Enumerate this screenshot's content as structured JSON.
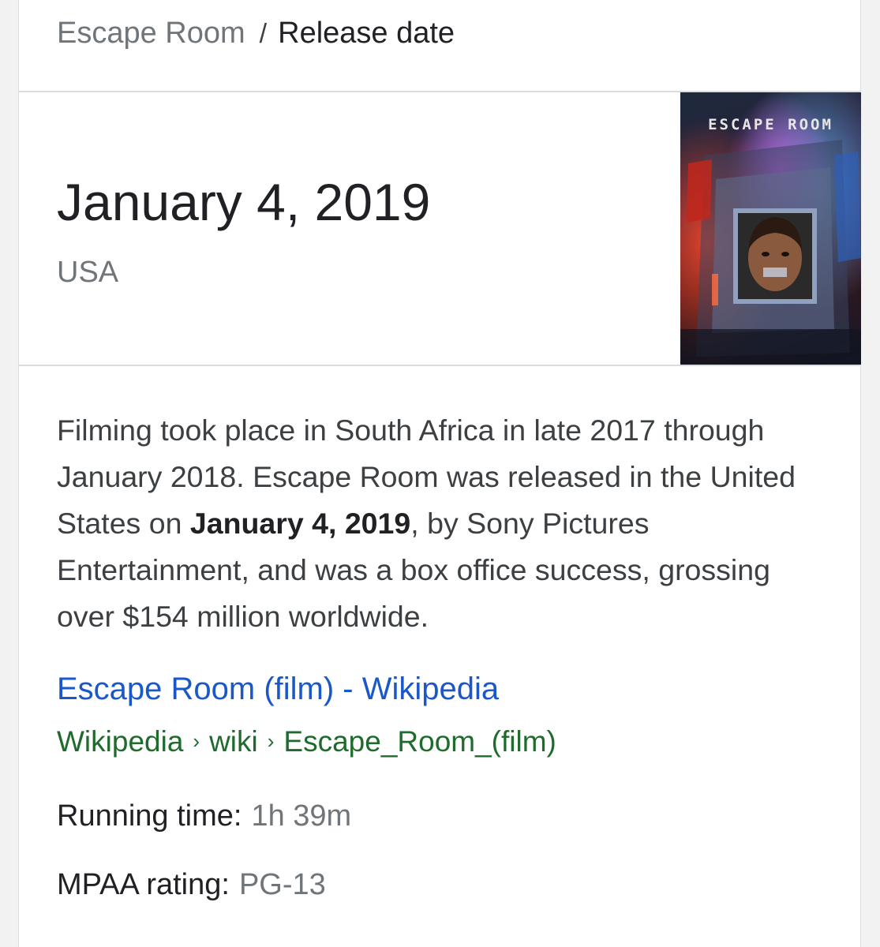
{
  "breadcrumb": {
    "parent": "Escape Room",
    "separator": "/",
    "current": "Release date"
  },
  "answer": {
    "date": "January 4, 2019",
    "region": "USA"
  },
  "poster": {
    "title": "ESCAPE ROOM",
    "icon": "movie-poster-image"
  },
  "snippet": {
    "before": "Filming took place in South Africa in late 2017 through January 2018. Escape Room was released in the United States on ",
    "bold": "January 4, 2019",
    "after": ", by Sony Pictures Entertainment, and was a box office success, grossing over $154 million worldwide."
  },
  "source": {
    "title": "Escape Room (film) - Wikipedia",
    "url_parts": [
      "Wikipedia",
      "wiki",
      "Escape_Room_(film)"
    ],
    "url_sep": "›"
  },
  "facts": {
    "running_time": {
      "label": "Running time:",
      "value": "1h 39m"
    },
    "mpaa_rating": {
      "label": "MPAA rating:",
      "value": "PG-13"
    }
  },
  "colors": {
    "link": "#1a57c9",
    "url": "#1e6b2c",
    "muted": "#70757a",
    "text": "#202124"
  }
}
